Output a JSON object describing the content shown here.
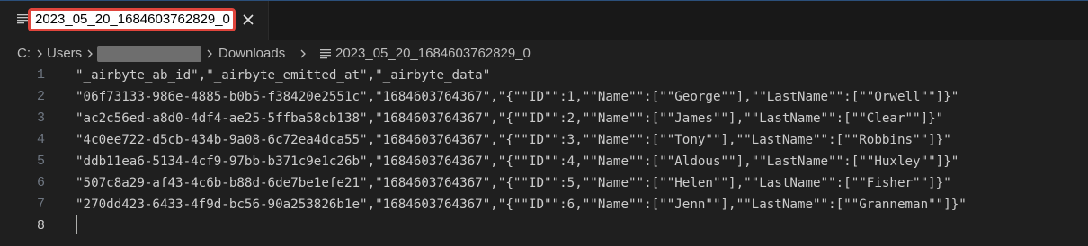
{
  "tab": {
    "title": "2023_05_20_1684603762829_0",
    "icon": "text-file-icon",
    "close_icon": "close-icon",
    "highlight_color": "#e0453c"
  },
  "breadcrumb": {
    "items": [
      "C:",
      "Users",
      "Downloads",
      "2023_05_20_1684603762829_0"
    ],
    "separator_icon": "chevron-right-icon",
    "file_icon": "text-file-icon"
  },
  "editor": {
    "lines": [
      {
        "number": "1",
        "text": "\"_airbyte_ab_id\",\"_airbyte_emitted_at\",\"_airbyte_data\""
      },
      {
        "number": "2",
        "text": "\"06f73133-986e-4885-b0b5-f38420e2551c\",\"1684603764367\",\"{\"\"ID\"\":1,\"\"Name\"\":[\"\"George\"\"],\"\"LastName\"\":[\"\"Orwell\"\"]}\""
      },
      {
        "number": "3",
        "text": "\"ac2c56ed-a8d0-4df4-ae25-5ffba58cb138\",\"1684603764367\",\"{\"\"ID\"\":2,\"\"Name\"\":[\"\"James\"\"],\"\"LastName\"\":[\"\"Clear\"\"]}\""
      },
      {
        "number": "4",
        "text": "\"4c0ee722-d5cb-434b-9a08-6c72ea4dca55\",\"1684603764367\",\"{\"\"ID\"\":3,\"\"Name\"\":[\"\"Tony\"\"],\"\"LastName\"\":[\"\"Robbins\"\"]}\""
      },
      {
        "number": "5",
        "text": "\"ddb11ea6-5134-4cf9-97bb-b371c9e1c26b\",\"1684603764367\",\"{\"\"ID\"\":4,\"\"Name\"\":[\"\"Aldous\"\"],\"\"LastName\"\":[\"\"Huxley\"\"]}\""
      },
      {
        "number": "6",
        "text": "\"507c8a29-af43-4c6b-b88d-6de7be1efe21\",\"1684603764367\",\"{\"\"ID\"\":5,\"\"Name\"\":[\"\"Helen\"\"],\"\"LastName\"\":[\"\"Fisher\"\"]}\""
      },
      {
        "number": "7",
        "text": "\"270dd423-6433-4f9d-bc56-90a253826b1e\",\"1684603764367\",\"{\"\"ID\"\":6,\"\"Name\"\":[\"\"Jenn\"\"],\"\"LastName\"\":[\"\"Granneman\"\"]}\""
      },
      {
        "number": "8",
        "text": ""
      }
    ]
  }
}
